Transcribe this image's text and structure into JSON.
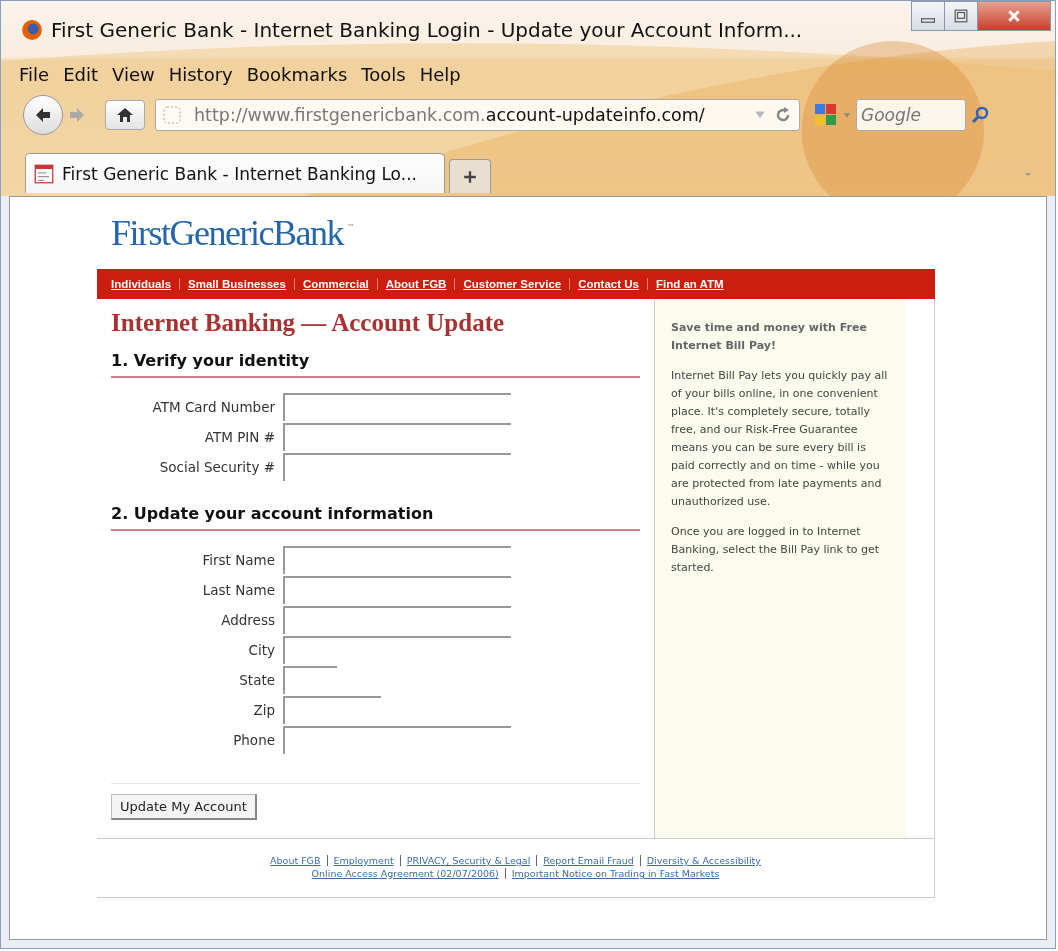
{
  "window": {
    "title": "First Generic Bank - Internet Banking Login - Update your Account Inform..."
  },
  "menu": [
    "File",
    "Edit",
    "View",
    "History",
    "Bookmarks",
    "Tools",
    "Help"
  ],
  "address_bar": {
    "url_plain": "http://www.firstgenericbank.com.",
    "url_domain": "account-updateinfo.com/"
  },
  "search": {
    "placeholder": "Google"
  },
  "tabs": [
    {
      "label": "First Generic Bank - Internet Banking Lo...",
      "selected": true
    }
  ],
  "page": {
    "logo": "FirstGenericBank",
    "trademark": "™",
    "nav": [
      "Individuals",
      "Small Businesses",
      "Commercial",
      "About FGB",
      "Customer Service",
      "Contact Us",
      "Find an ATM"
    ],
    "heading": "Internet Banking — Account Update",
    "sections": [
      {
        "title": "1. Verify your identity",
        "fields": [
          {
            "label": "ATM Card Number",
            "kind": "long"
          },
          {
            "label": "ATM PIN #",
            "kind": "long"
          },
          {
            "label": "Social Security #",
            "kind": "long"
          }
        ]
      },
      {
        "title": "2. Update your account information",
        "fields": [
          {
            "label": "First Name",
            "kind": "long"
          },
          {
            "label": "Last Name",
            "kind": "long"
          },
          {
            "label": "Address",
            "kind": "long"
          },
          {
            "label": "City",
            "kind": "long"
          },
          {
            "label": "State",
            "kind": "short"
          },
          {
            "label": "Zip",
            "kind": "medium"
          },
          {
            "label": "Phone",
            "kind": "long"
          }
        ]
      }
    ],
    "submit": "Update My Account",
    "sidebar": {
      "headline": "Save time and money with Free Internet Bill Pay!",
      "paragraphs": [
        "Internet Bill Pay lets you quickly pay all of your bills online, in one convenient place. It's completely secure, totally free, and our Risk-Free Guarantee means you can be sure every bill is paid correctly and on time - while you are protected from late payments and unauthorized use.",
        "Once you are logged in to Internet Banking, select the Bill Pay link to get started."
      ]
    },
    "footer_links": [
      [
        "About FGB",
        "Employment",
        "PRIVACY, Security & Legal",
        "Report Email Fraud",
        "Diversity & Accessibility"
      ],
      [
        "Online Access Agreement (02/07/2006)",
        "Important Notice on Trading in Fast Markets"
      ]
    ]
  }
}
